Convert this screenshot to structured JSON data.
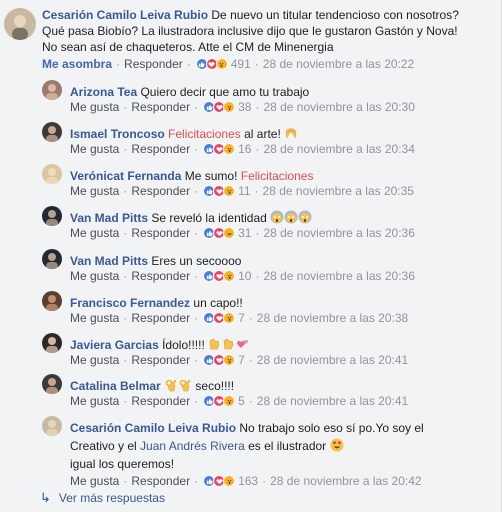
{
  "top": {
    "author": "Cesarión Camilo Leiva Rubio",
    "text": "De nuevo un titular tendencioso con nosotros? Qué pasa Biobío? La ilustradora inclusive dijo que le gustaron Gastón y Nova! No sean así de chaqueteros. Atte el CM de Minenergia",
    "reaction_label": "Me asombra",
    "reply_label": "Responder",
    "count": "491",
    "time": "28 de noviembre a las 20:22"
  },
  "labels": {
    "like": "Me gusta",
    "reply": "Responder",
    "more_replies": "Ver más respuestas"
  },
  "replies": [
    {
      "author": "Arizona Tea",
      "text": "Quiero decir que amo tu trabajo",
      "count": "38",
      "time": "28 de noviembre a las 20:30"
    },
    {
      "author": "Ismael Troncoso",
      "highlight": "Felicitaciones",
      "text": "al arte!",
      "emoji": "raise-hands",
      "count": "16",
      "time": "28 de noviembre a las 20:34"
    },
    {
      "author": "Verónicat Fernanda",
      "text": "Me sumo!",
      "highlight": "Felicitaciones",
      "count": "11",
      "time": "28 de noviembre a las 20:35"
    },
    {
      "author": "Van Mad Pitts",
      "text": "Se reveló la identidad",
      "emoji": "scream x3",
      "count": "31",
      "time": "28 de noviembre a las 20:36"
    },
    {
      "author": "Van Mad Pitts",
      "text": "Eres un secoooo",
      "count": "10",
      "time": "28 de noviembre a las 20:36"
    },
    {
      "author": "Francisco Fernandez",
      "text": "un capo!!",
      "count": "7",
      "time": "28 de noviembre a las 20:38"
    },
    {
      "author": "Javiera Garcias",
      "text": "Ídolo!!!!!",
      "emoji": "clap clap hearts",
      "count": "7",
      "time": "28 de noviembre a las 20:41"
    },
    {
      "author": "Catalina Belmar",
      "text": "seco!!!!",
      "emoji": "ok-hand x2",
      "count": "5",
      "time": "28 de noviembre a las 20:41"
    },
    {
      "author": "Cesarión Camilo Leiva Rubio",
      "text1": "No trabajo solo eso sí po.Yo soy el Creativo y el",
      "link": "Juan Andrés Rivera",
      "text2": "es el ilustrador",
      "emoji": "heart-eyes",
      "text3": "igual los queremos!",
      "count": "163",
      "time": "28 de noviembre a las 20:42"
    }
  ],
  "colors": {
    "name": "#385898",
    "highlight": "#e64d4d",
    "meta": "#90949c",
    "accent": "#4267b2",
    "background": "#f2f3f5"
  }
}
